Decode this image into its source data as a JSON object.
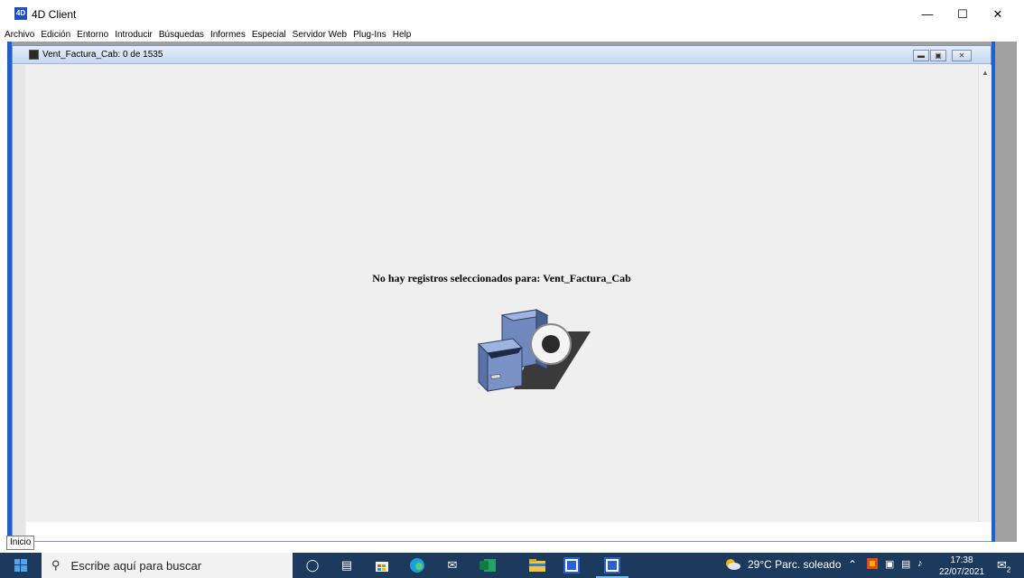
{
  "app": {
    "title": "4D Client",
    "icon_text": "4D"
  },
  "menu": [
    "Archivo",
    "Edición",
    "Entorno",
    "Introducir",
    "Búsquedas",
    "Informes",
    "Especial",
    "Servidor Web",
    "Plug-Ins",
    "Help"
  ],
  "child_window": {
    "title": "Vent_Factura_Cab: 0 de 1535",
    "empty_message": "No hay registros seleccionados para: Vent_Factura_Cab"
  },
  "taskbar": {
    "start_tooltip": "Inicio",
    "search_placeholder": "Escribe aquí para buscar",
    "weather": "29°C  Parc. soleado",
    "time": "17:38",
    "date": "22/07/2021",
    "notification_count": "2",
    "pinned_icons": [
      "cortana-icon",
      "task-view-icon",
      "store-icon",
      "edge-icon",
      "mail-icon",
      "excel-icon",
      "file-explorer-icon",
      "4d-icon",
      "4d-active-icon"
    ]
  },
  "colors": {
    "accent": "#1f5fcf",
    "taskbar": "#1b3a5c",
    "mdi_background": "#a0a0a0"
  }
}
